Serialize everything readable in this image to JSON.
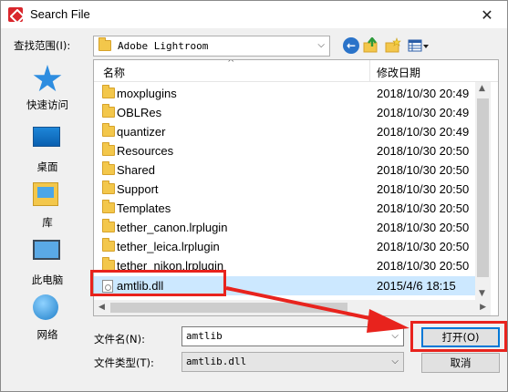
{
  "window": {
    "title": "Search File",
    "close_glyph": "✕"
  },
  "toolbar": {
    "lookin_label": "查找范围(I):",
    "lookin_value": "Adobe Lightroom",
    "icons": [
      "back-icon",
      "up-folder-icon",
      "new-folder-icon",
      "view-menu-icon"
    ]
  },
  "places": [
    {
      "label": "快速访问",
      "icon": "star-icon"
    },
    {
      "label": "桌面",
      "icon": "desktop-icon"
    },
    {
      "label": "库",
      "icon": "library-icon"
    },
    {
      "label": "此电脑",
      "icon": "computer-icon"
    },
    {
      "label": "网络",
      "icon": "network-icon"
    }
  ],
  "columns": {
    "name": "名称",
    "date": "修改日期"
  },
  "files": [
    {
      "name": "moxplugins",
      "date": "2018/10/30 20:49",
      "type": "folder"
    },
    {
      "name": "OBLRes",
      "date": "2018/10/30 20:49",
      "type": "folder"
    },
    {
      "name": "quantizer",
      "date": "2018/10/30 20:49",
      "type": "folder"
    },
    {
      "name": "Resources",
      "date": "2018/10/30 20:50",
      "type": "folder"
    },
    {
      "name": "Shared",
      "date": "2018/10/30 20:50",
      "type": "folder"
    },
    {
      "name": "Support",
      "date": "2018/10/30 20:50",
      "type": "folder"
    },
    {
      "name": "Templates",
      "date": "2018/10/30 20:50",
      "type": "folder"
    },
    {
      "name": "tether_canon.lrplugin",
      "date": "2018/10/30 20:50",
      "type": "folder"
    },
    {
      "name": "tether_leica.lrplugin",
      "date": "2018/10/30 20:50",
      "type": "folder"
    },
    {
      "name": "tether_nikon.lrplugin",
      "date": "2018/10/30 20:50",
      "type": "folder"
    },
    {
      "name": "amtlib.dll",
      "date": "2015/4/6 18:15",
      "type": "file",
      "selected": true
    }
  ],
  "filename": {
    "label": "文件名(N):",
    "value": "amtlib"
  },
  "filetype": {
    "label": "文件类型(T):",
    "value": "amtlib.dll"
  },
  "buttons": {
    "open": "打开(O)",
    "cancel": "取消"
  },
  "annotation": {
    "color": "#e8231d"
  }
}
